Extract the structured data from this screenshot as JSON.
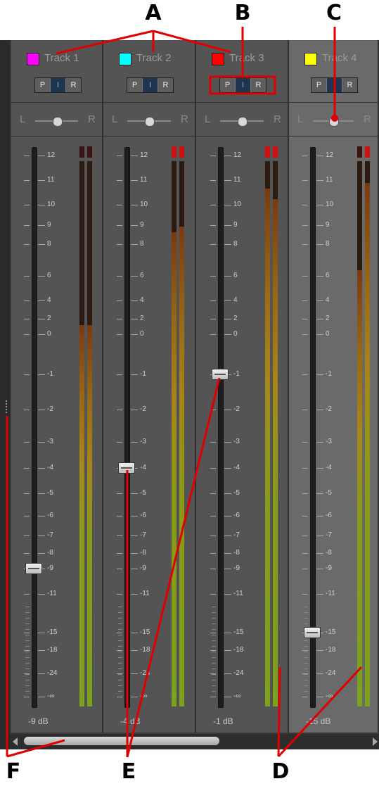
{
  "annotations": {
    "A": "A",
    "B": "B",
    "C": "C",
    "D": "D",
    "E": "E",
    "F": "F"
  },
  "colors": {
    "annotation_red": "#e00000",
    "strip_bg": "#545454",
    "strip_selected_bg": "#6a6a6a"
  },
  "pir_labels": [
    "P",
    "I",
    "R"
  ],
  "pan": {
    "left": "L",
    "right": "R"
  },
  "scale_labels": [
    "12",
    "11",
    "10",
    "9",
    "8",
    "6",
    "4",
    "2",
    "0",
    "-1",
    "-2",
    "-3",
    "-4",
    "-5",
    "-6",
    "-7",
    "-8",
    "-9",
    "-11",
    "-15",
    "-18",
    "-24",
    "-∞"
  ],
  "tracks": [
    {
      "name": "Track 1",
      "color": "#ff00ff",
      "volume_db": -9,
      "volume_label": "-9 dB",
      "meter_fill": [
        0.7,
        0.7
      ],
      "clip": [
        false,
        false
      ],
      "selected": false
    },
    {
      "name": "Track 2",
      "color": "#00ffff",
      "volume_db": -4,
      "volume_label": "-4 dB",
      "meter_fill": [
        0.87,
        0.88
      ],
      "clip": [
        true,
        true
      ],
      "selected": false
    },
    {
      "name": "Track 3",
      "color": "#ff0000",
      "volume_db": -1,
      "volume_label": "-1 dB",
      "meter_fill": [
        0.95,
        0.93
      ],
      "clip": [
        true,
        true
      ],
      "selected": false
    },
    {
      "name": "Track 4",
      "color": "#ffff00",
      "volume_db": -15,
      "volume_label": "-15 dB",
      "meter_fill": [
        0.8,
        0.96
      ],
      "clip": [
        false,
        true
      ],
      "selected": true
    }
  ]
}
